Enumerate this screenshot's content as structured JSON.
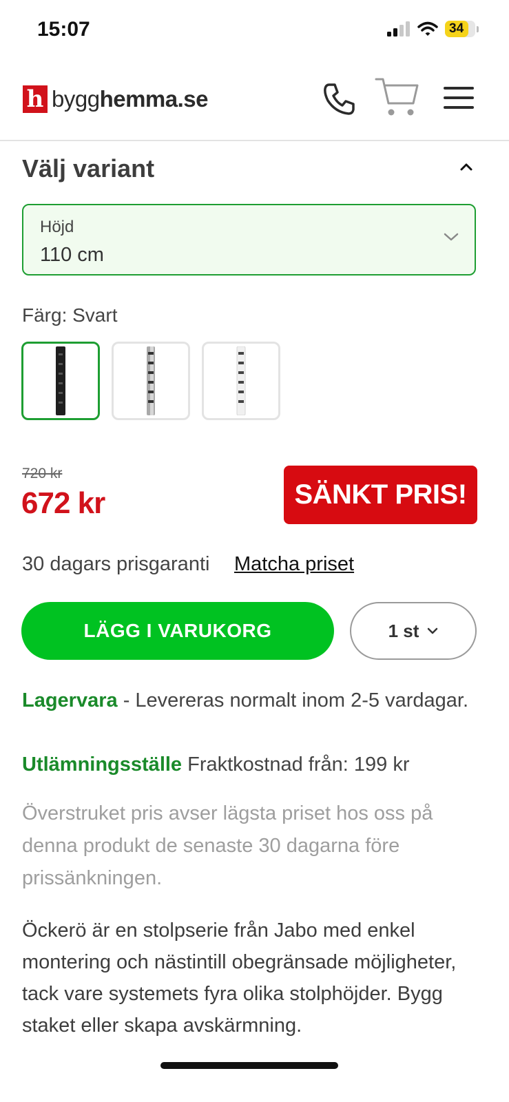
{
  "status_bar": {
    "time": "15:07",
    "battery": "34"
  },
  "header": {
    "logo_mark": "h",
    "logo_text_light": "bygg",
    "logo_text_bold": "hemma.se",
    "icons": [
      "phone-icon",
      "cart-icon",
      "menu-icon"
    ]
  },
  "variant": {
    "title": "Välj variant",
    "height_label": "Höjd",
    "height_value": "110 cm",
    "color_label": "Färg: Svart",
    "swatches": [
      {
        "name": "Svart",
        "color": "#222222",
        "selected": true
      },
      {
        "name": "Galvaniserad",
        "color": "#9a9a9a",
        "selected": false
      },
      {
        "name": "Vit",
        "color": "#f2f2f2",
        "selected": false
      }
    ]
  },
  "price": {
    "old": "720 kr",
    "new": "672 kr",
    "badge": "SÄNKT PRIS!"
  },
  "guarantee": {
    "text": "30 dagars prisgaranti",
    "link": "Matcha priset"
  },
  "actions": {
    "add_to_cart": "LÄGG I VARUKORG",
    "quantity": "1 st"
  },
  "delivery": {
    "stock_status": "Lagervara",
    "stock_text": " - Levereras normalt inom 2-5 vardagar.",
    "pickup_status": "Utlämningsställe",
    "pickup_text": " Fraktkostnad från: 199 kr"
  },
  "disclaimer": "Överstruket pris avser lägsta priset hos oss på denna produkt de senaste 30 dagarna före prissänkningen.",
  "description": "Öckerö är en stolpserie från Jabo med enkel montering och nästintill obegränsade möjligheter, tack vare systemets fyra olika stolphöjder. Bygg staket eller skapa avskärmning.",
  "colors": {
    "accent_green": "#00c221",
    "border_green": "#1e9e32",
    "sale_red": "#d70b11",
    "price_red": "#d1121b"
  }
}
